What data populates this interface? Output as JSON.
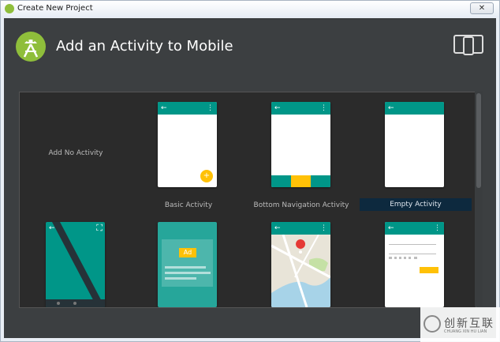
{
  "window": {
    "title": "Create New Project",
    "close_label": "✕"
  },
  "header": {
    "title": "Add an Activity to Mobile",
    "logo_icon": "android-studio-icon",
    "device_icon": "phone-tablet-icon"
  },
  "gallery": {
    "items": [
      {
        "caption": "Add No Activity",
        "selected": false
      },
      {
        "caption": "Basic Activity",
        "selected": false,
        "fab_label": "+"
      },
      {
        "caption": "Bottom Navigation Activity",
        "selected": false
      },
      {
        "caption": "Empty Activity",
        "selected": true
      },
      {
        "caption": "",
        "selected": false
      },
      {
        "caption": "",
        "selected": false,
        "ad_label": "Ad"
      },
      {
        "caption": "",
        "selected": false
      },
      {
        "caption": "",
        "selected": false
      }
    ],
    "toolbar": {
      "back_glyph": "←",
      "menu_glyph": "⋮",
      "fullscreen_glyph": "⛶"
    }
  },
  "watermark": {
    "text": "创新互联",
    "subtext": "CHUANG XIN HU LIAN"
  },
  "colors": {
    "teal": "#009688",
    "amber": "#FFC107",
    "header_bg": "#3C3F41",
    "gallery_bg": "#2B2B2B",
    "selected_bg": "#0D293E"
  }
}
